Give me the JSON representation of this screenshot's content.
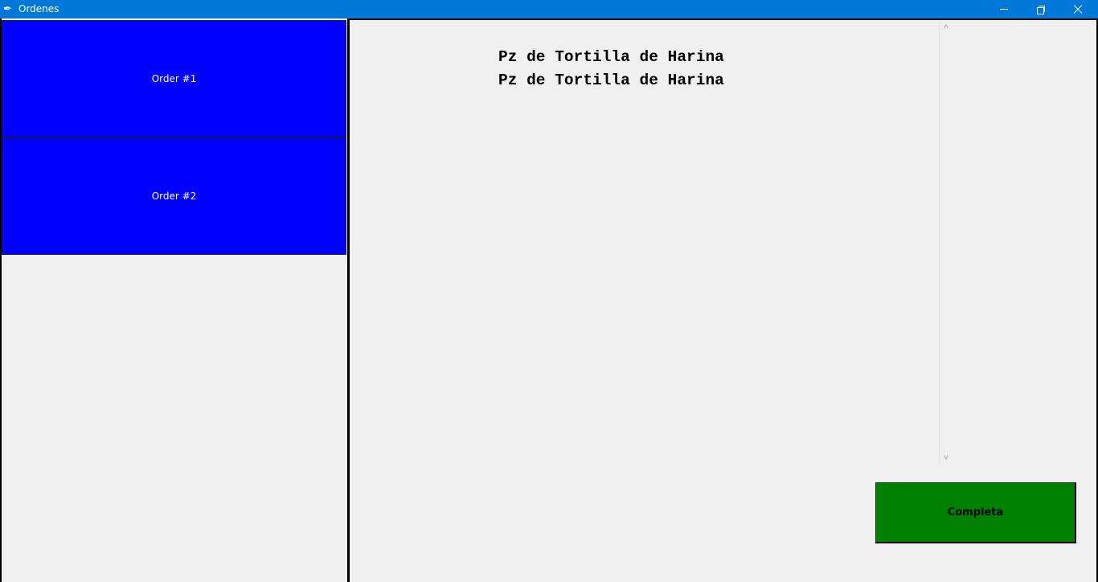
{
  "window": {
    "title": "Ordenes",
    "app_icon": "feather-icon",
    "controls": [
      "minimize-icon",
      "restore-icon",
      "close-icon"
    ]
  },
  "orders": [
    {
      "label": "Order #1"
    },
    {
      "label": "Order #2"
    }
  ],
  "detail": {
    "lines": [
      "Pz de Tortilla de Harina",
      "Pz de Tortilla de Harina"
    ]
  },
  "actions": {
    "complete_label": "Completa"
  },
  "colors": {
    "titlebar": "#0078d7",
    "order_button": "#0000ff",
    "complete_button": "#008000",
    "background": "#f0f0f0"
  }
}
